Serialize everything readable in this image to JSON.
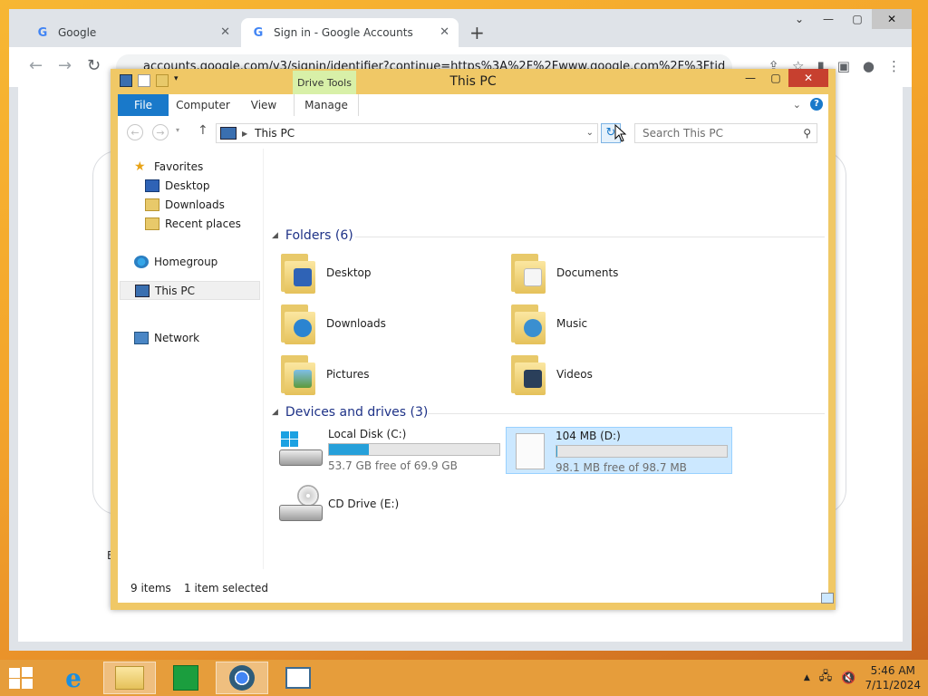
{
  "chrome": {
    "tabs": [
      {
        "label": "Google"
      },
      {
        "label": "Sign in - Google Accounts"
      }
    ],
    "url": "accounts.google.com/v3/signin/identifier?continue=https%3A%2F%2Fwww.google.com%2F%3Ftid",
    "footer_text": "En"
  },
  "explorer": {
    "title": "This PC",
    "contextual_tab": "Drive Tools",
    "ribbon_tabs": [
      "File",
      "Computer",
      "View",
      "Manage"
    ],
    "address_path": "This PC",
    "search_placeholder": "Search This PC",
    "nav": {
      "favorites": "Favorites",
      "desktop": "Desktop",
      "downloads": "Downloads",
      "recent": "Recent places",
      "homegroup": "Homegroup",
      "this_pc": "This PC",
      "network": "Network"
    },
    "folders_header": "Folders (6)",
    "folders": [
      {
        "label": "Desktop"
      },
      {
        "label": "Documents"
      },
      {
        "label": "Downloads"
      },
      {
        "label": "Music"
      },
      {
        "label": "Pictures"
      },
      {
        "label": "Videos"
      }
    ],
    "drives_header": "Devices and drives (3)",
    "drives": [
      {
        "name": "Local Disk (C:)",
        "free": "53.7 GB free of 69.9 GB",
        "used_fraction": 0.232
      },
      {
        "name": "104 MB (D:)",
        "free": "98.1 MB free of 98.7 MB",
        "used_fraction": 0.006
      },
      {
        "name": "CD Drive (E:)"
      }
    ],
    "status": {
      "items": "9 items",
      "selected": "1 item selected"
    }
  },
  "taskbar": {
    "time": "5:46 AM",
    "date": "7/11/2024"
  },
  "colors": {
    "accent": "#1979ca",
    "title_bar": "#f0c866",
    "drive_bar": "#26a0da",
    "selection": "#cce8ff",
    "close": "#c7402f"
  }
}
